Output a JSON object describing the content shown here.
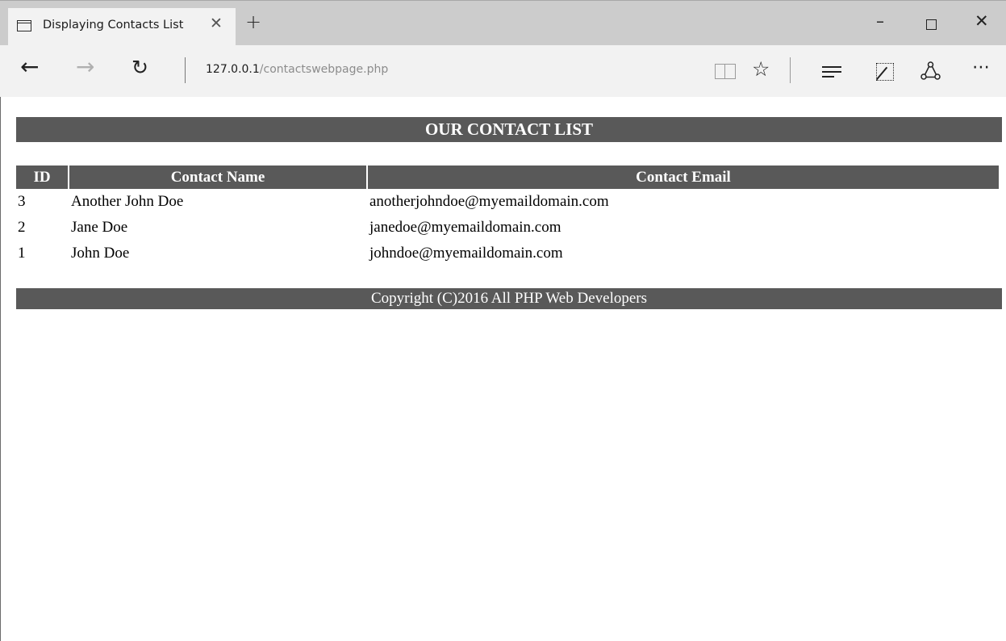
{
  "browser": {
    "tab_title": "Displaying Contacts List",
    "tab_close": "✕",
    "new_tab": "+",
    "address_host": "127.0.0.1",
    "address_path": "/contactswebpage.php",
    "icons": [
      "page-icon",
      "back-arrow-icon",
      "forward-arrow-icon",
      "refresh-icon",
      "reading-view-icon",
      "favorite-star-icon",
      "hub-icon",
      "web-note-icon",
      "share-icon",
      "more-icon",
      "minimize-icon",
      "maximize-icon",
      "close-icon"
    ]
  },
  "page": {
    "header": "OUR CONTACT LIST",
    "table": {
      "columns": [
        "ID",
        "Contact Name",
        "Contact Email"
      ],
      "rows": [
        {
          "id": "3",
          "name": "Another John Doe",
          "email": "anotherjohndoe@myemaildomain.com"
        },
        {
          "id": "2",
          "name": "Jane Doe",
          "email": "janedoe@myemaildomain.com"
        },
        {
          "id": "1",
          "name": "John Doe",
          "email": "johndoe@myemaildomain.com"
        }
      ]
    },
    "footer": "Copyright (C)2016 All PHP Web Developers"
  },
  "colors": {
    "header_bg": "#595959",
    "header_text": "#ffffff",
    "chrome_title_bg": "#cccccc",
    "chrome_nav_bg": "#f2f2f2"
  }
}
